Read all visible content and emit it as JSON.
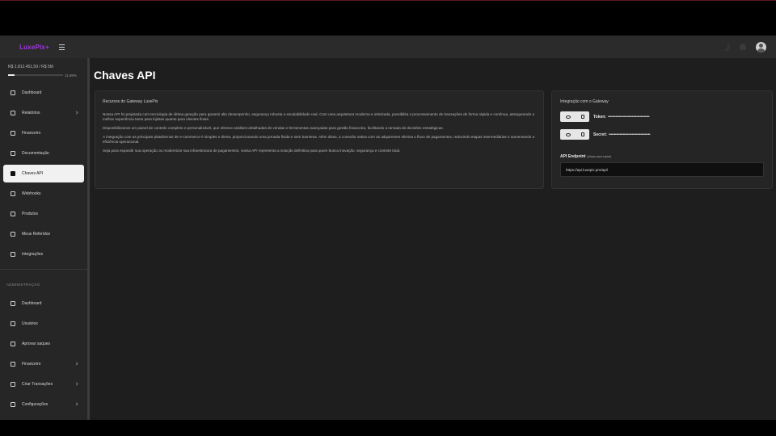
{
  "header": {
    "logo": "LuxePix+"
  },
  "sidebar": {
    "balance": "R$ 1.812.451,59 / R$ 5M",
    "progress_pct": "11,98%",
    "progress_value": 0.1198,
    "items": [
      {
        "label": "Dashboard",
        "icon": "monitor-icon"
      },
      {
        "label": "Relatórios",
        "icon": "chart-icon",
        "chevron": true
      },
      {
        "label": "Financeiro",
        "icon": "wallet-icon"
      },
      {
        "label": "Documentação",
        "icon": "document-icon"
      },
      {
        "label": "Chaves API",
        "icon": "code-icon",
        "active": true
      },
      {
        "label": "Webhooks",
        "icon": "webhook-icon"
      },
      {
        "label": "Produtos",
        "icon": "box-icon"
      },
      {
        "label": "Meus Referidos",
        "icon": "users-icon"
      },
      {
        "label": "Integrações",
        "icon": "link-icon"
      }
    ],
    "admin_label": "ADMINISTRAÇÃO",
    "admin_items": [
      {
        "label": "Dashboard",
        "icon": "grid-icon"
      },
      {
        "label": "Usuários",
        "icon": "users-icon"
      },
      {
        "label": "Aprovar saques",
        "icon": "check-icon"
      },
      {
        "label": "Financeiro",
        "icon": "wallet-icon",
        "chevron": true
      },
      {
        "label": "Criar Transações",
        "icon": "transaction-icon",
        "chevron": true
      },
      {
        "label": "Configurações",
        "icon": "gear-icon",
        "chevron": true
      }
    ]
  },
  "main": {
    "title": "Chaves API",
    "resources": {
      "title": "Recursos do Gateway LuxePix",
      "paragraphs": [
        "Nossa API foi projetada com tecnologia de última geração para garantir alto desempenho, segurança robusta e escalabilidade real. Com uma arquitetura moderna e otimizada, possibilita o processamento de transações de forma rápida e contínua, assegurando a melhor experiência tanto para lojistas quanto para clientes finais.",
        "Disponibilizamos um painel de controle completo e personalizável, que oferece análises detalhadas de vendas e ferramentas avançadas para gestão financeira, facilitando a tomada de decisões estratégicas.",
        "A integração com as principais plataformas de e-commerce é simples e direta, proporcionando uma jornada fluida e sem barreiras. Além disso, a conexão nativa com as adquirentes elimina o fluxo de pagamentos, reduzindo etapas intermediárias e aumentando a eficiência operacional.",
        "Seja para expandir sua operação ou modernizar sua infraestrutura de pagamentos, nossa API representa a solução definitiva para quem busca inovação, segurança e controle total."
      ]
    },
    "integration": {
      "title": "Integração com o Gateway",
      "token_label": "Token:",
      "token_mask": "••••••••••••••••••••••••••••••••••••••",
      "secret_label": "Secret:",
      "secret_mask": "••••••••••••••••••••••••••••••••••••••",
      "endpoint_label": "API Endpoint",
      "endpoint_hint": "(clique para copiar)",
      "endpoint_value": "https://api.luxepix.pro/api/"
    }
  }
}
